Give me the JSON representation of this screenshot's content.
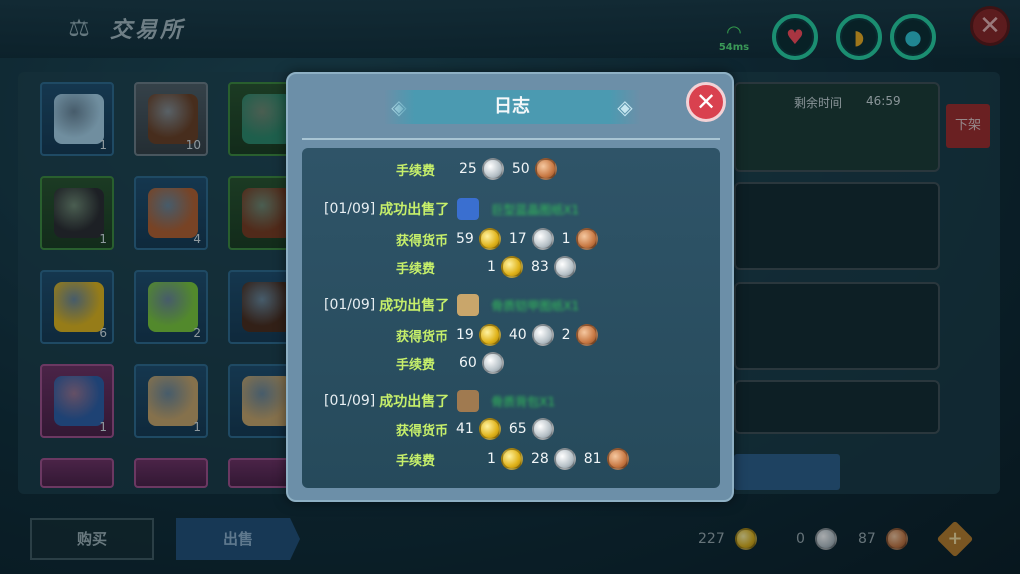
{
  "header": {
    "title": "交易所",
    "ping": "54ms"
  },
  "inventory": {
    "slots": [
      {
        "count": "1",
        "rarity": "blue",
        "color": "#a9d3ea"
      },
      {
        "count": "10",
        "rarity": "gray",
        "color": "#6b3e22"
      },
      {
        "count": "",
        "rarity": "green",
        "color": "#2c8a6a"
      },
      {
        "count": "1",
        "rarity": "green",
        "color": "#2a2a2e"
      },
      {
        "count": "4",
        "rarity": "blue",
        "color": "#b5602f"
      },
      {
        "count": "",
        "rarity": "green",
        "color": "#7a3a1e"
      },
      {
        "count": "6",
        "rarity": "blue",
        "color": "#e3b71b"
      },
      {
        "count": "2",
        "rarity": "blue",
        "color": "#7ccb3a"
      },
      {
        "count": "",
        "rarity": "blue",
        "color": "#4a2a1a"
      },
      {
        "count": "1",
        "rarity": "purple",
        "color": "#2b5ea8"
      },
      {
        "count": "1",
        "rarity": "blue",
        "color": "#c9a66b"
      },
      {
        "count": "",
        "rarity": "blue",
        "color": "#c9a66b"
      }
    ]
  },
  "listing": {
    "time_label": "剩余时间",
    "time_value": "46:59",
    "remove_label": "下架"
  },
  "bottom": {
    "buy_label": "购买",
    "sell_label": "出售",
    "gold": "227",
    "silver": "0",
    "copper": "87"
  },
  "log": {
    "title": "日志",
    "fee_label": "手续费",
    "earn_label": "获得货币",
    "sold_label": "成功出售了",
    "first_fee": {
      "silver": "25",
      "copper": "50"
    },
    "entries": [
      {
        "date": "[01/09]",
        "item_name": "巨型蓝晶图纸X1",
        "item_color": "#3a6fd0",
        "earn": {
          "gold": "59",
          "silver": "17",
          "copper": "1"
        },
        "fee": {
          "gold": "1",
          "silver": "83"
        }
      },
      {
        "date": "[01/09]",
        "item_name": "骨质铠甲图纸X1",
        "item_color": "#c9a66b",
        "earn": {
          "gold": "19",
          "silver": "40",
          "copper": "2"
        },
        "fee": {
          "silver": "60"
        }
      },
      {
        "date": "[01/09]",
        "item_name": "骨质背包X1",
        "item_color": "#a07a50",
        "earn": {
          "gold": "41",
          "silver": "65"
        },
        "fee": {
          "gold": "1",
          "silver": "28",
          "copper": "81"
        }
      }
    ]
  },
  "colors": {
    "accent_green": "#c6ef6a",
    "close_red": "#d9414f"
  }
}
